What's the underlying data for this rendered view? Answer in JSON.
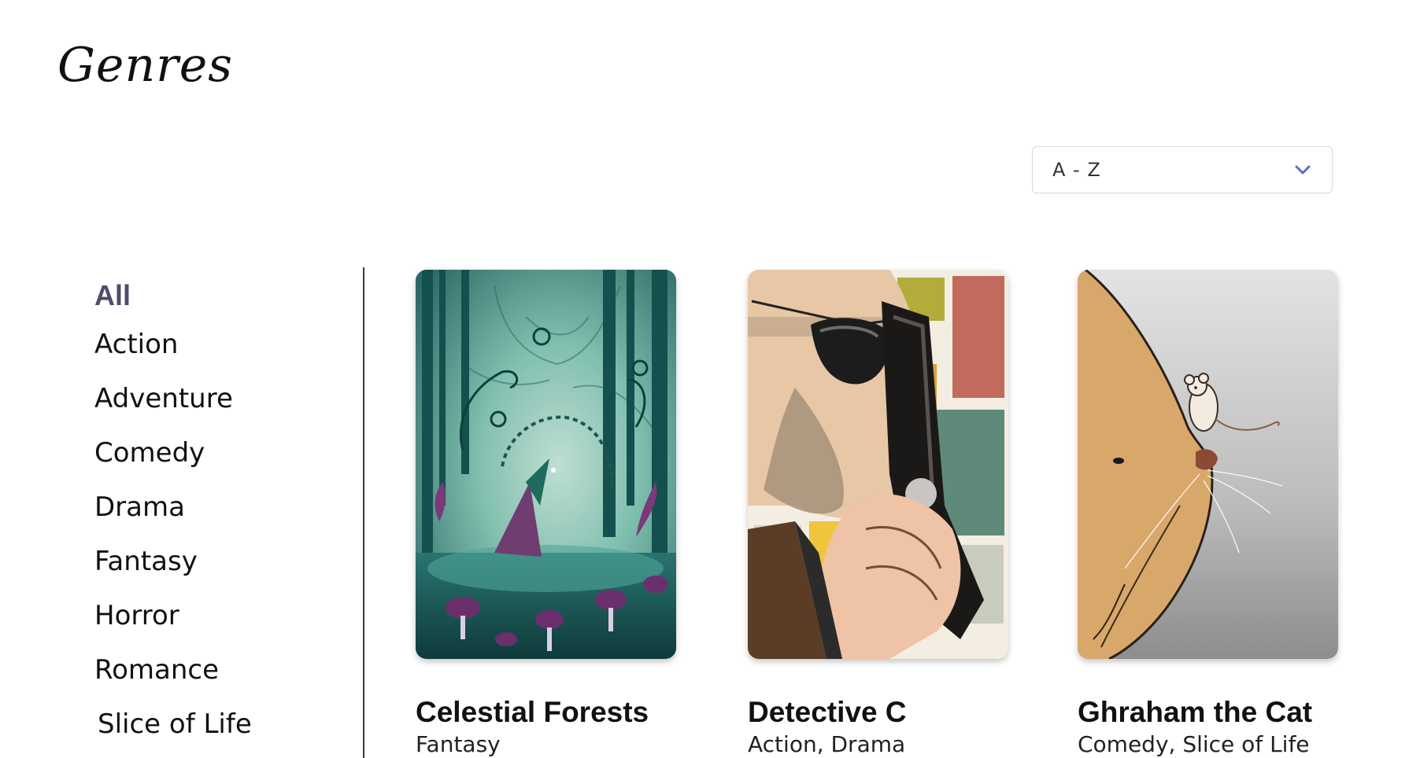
{
  "header": {
    "title": "Genres"
  },
  "sort": {
    "selected": "A - Z",
    "icon": "chevron-down-icon",
    "accent_color": "#5a6fc4"
  },
  "sidebar": {
    "items": [
      {
        "label": "All",
        "active": true
      },
      {
        "label": "Action",
        "active": false
      },
      {
        "label": "Adventure",
        "active": false
      },
      {
        "label": "Comedy",
        "active": false
      },
      {
        "label": "Drama",
        "active": false
      },
      {
        "label": "Fantasy",
        "active": false
      },
      {
        "label": "Horror",
        "active": false
      },
      {
        "label": "Romance",
        "active": false
      },
      {
        "label": "Slice of Life",
        "active": false
      }
    ],
    "active_color": "#4d4b6e"
  },
  "cards": [
    {
      "title": "Celestial Forests",
      "genres": "Fantasy"
    },
    {
      "title": "Detective C",
      "genres": "Action, Drama"
    },
    {
      "title": "Ghraham the Cat",
      "genres": "Comedy, Slice of Life"
    }
  ]
}
